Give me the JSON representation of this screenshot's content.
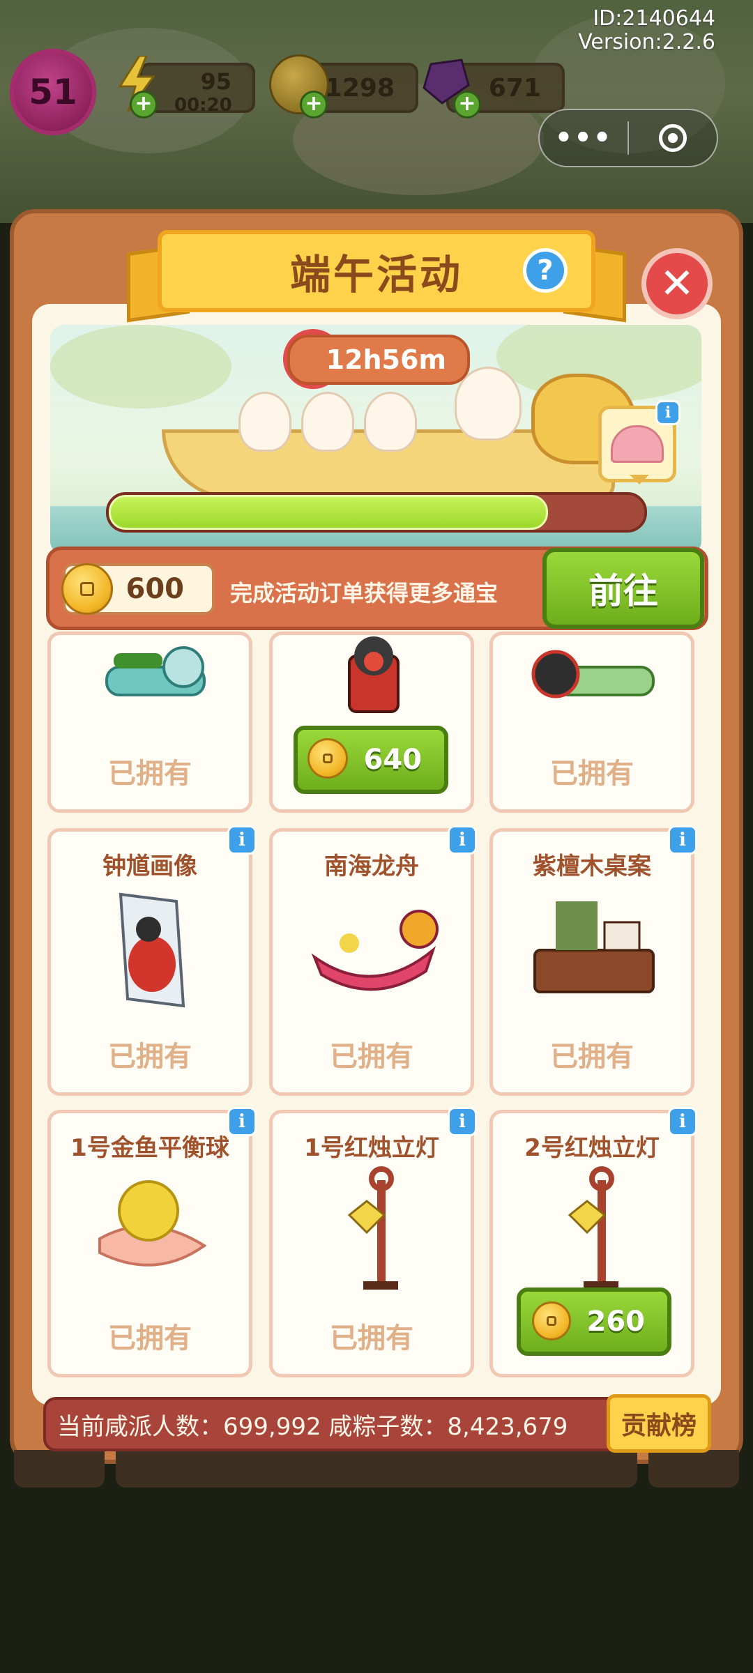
{
  "hud": {
    "id_text": "ID:2140644",
    "version_text": "Version:2.2.6",
    "level": "51",
    "energy": "95",
    "energy_timer": "00:20",
    "coins": "1298",
    "gems": "671"
  },
  "modal": {
    "title": "端午活动",
    "timer": "12h56m",
    "progress": 0.82,
    "coin_balance": "600",
    "task_text": "完成活动订单获得更多通宝",
    "go_label": "前往"
  },
  "items": [
    {
      "name": "",
      "status": "已拥有",
      "price": ""
    },
    {
      "name": "",
      "status": "",
      "price": "640"
    },
    {
      "name": "",
      "status": "已拥有",
      "price": ""
    },
    {
      "name": "钟馗画像",
      "status": "已拥有",
      "price": ""
    },
    {
      "name": "南海龙舟",
      "status": "已拥有",
      "price": ""
    },
    {
      "name": "紫檀木桌案",
      "status": "已拥有",
      "price": ""
    },
    {
      "name": "1号金鱼平衡球",
      "status": "已拥有",
      "price": ""
    },
    {
      "name": "1号红烛立灯",
      "status": "已拥有",
      "price": ""
    },
    {
      "name": "2号红烛立灯",
      "status": "",
      "price": "260"
    }
  ],
  "stats": {
    "text": "当前咸派人数：699,992   咸粽子数：8,423,679",
    "rank_label": "贡献榜"
  },
  "colors": {
    "accent_green": "#7cc12a",
    "panel_brown": "#c77a43",
    "banner_yellow": "#ffd24c",
    "close_red": "#e54a4a"
  }
}
